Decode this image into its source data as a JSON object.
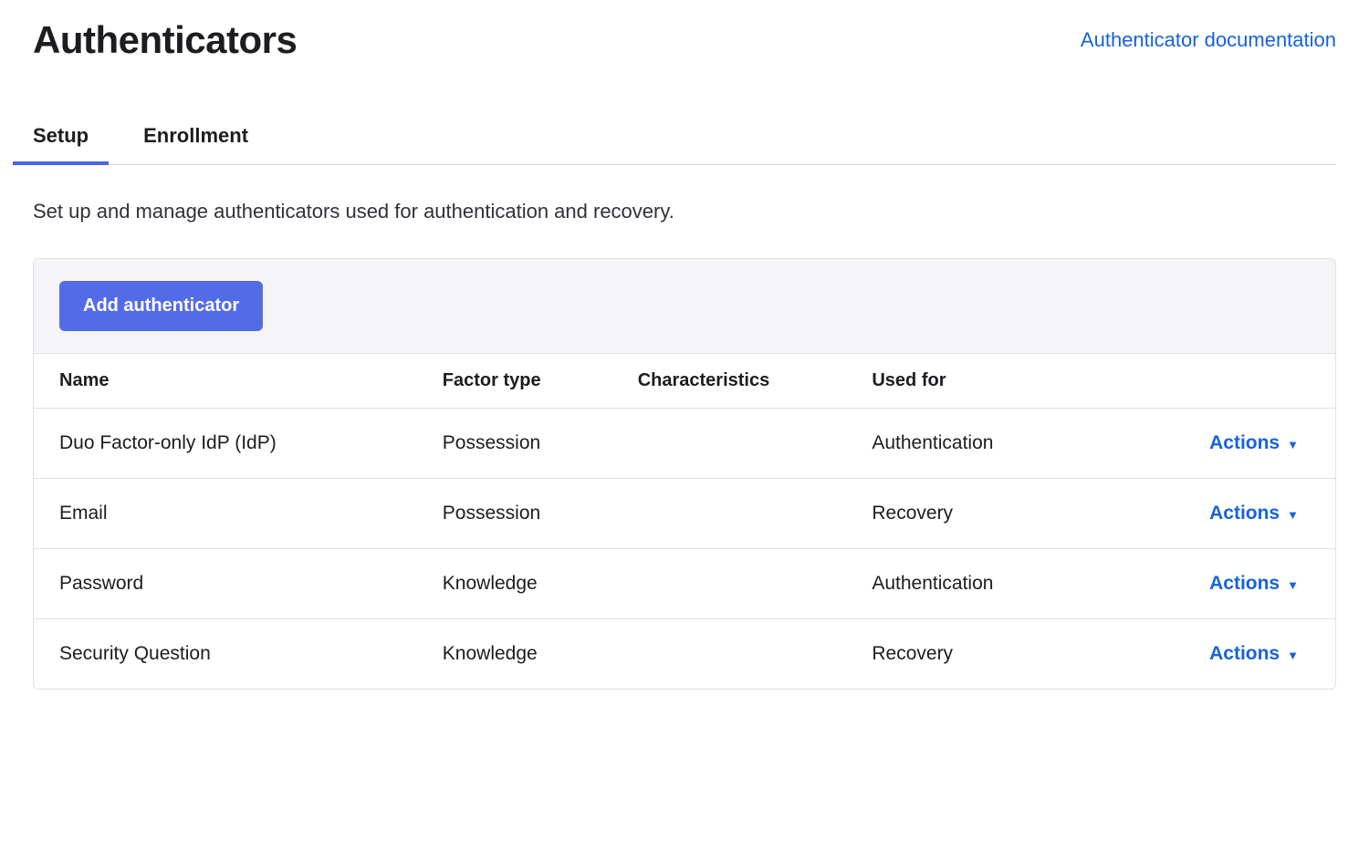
{
  "header": {
    "title": "Authenticators",
    "docLinkLabel": "Authenticator documentation"
  },
  "tabs": [
    {
      "label": "Setup",
      "active": true
    },
    {
      "label": "Enrollment",
      "active": false
    }
  ],
  "description": "Set up and manage authenticators used for authentication and recovery.",
  "addButtonLabel": "Add authenticator",
  "table": {
    "columns": [
      "Name",
      "Factor type",
      "Characteristics",
      "Used for",
      ""
    ],
    "rows": [
      {
        "name": "Duo Factor-only IdP (IdP)",
        "factorType": "Possession",
        "characteristics": "",
        "usedFor": "Authentication"
      },
      {
        "name": "Email",
        "factorType": "Possession",
        "characteristics": "",
        "usedFor": "Recovery"
      },
      {
        "name": "Password",
        "factorType": "Knowledge",
        "characteristics": "",
        "usedFor": "Authentication"
      },
      {
        "name": "Security Question",
        "factorType": "Knowledge",
        "characteristics": "",
        "usedFor": "Recovery"
      }
    ],
    "actionsLabel": "Actions"
  }
}
